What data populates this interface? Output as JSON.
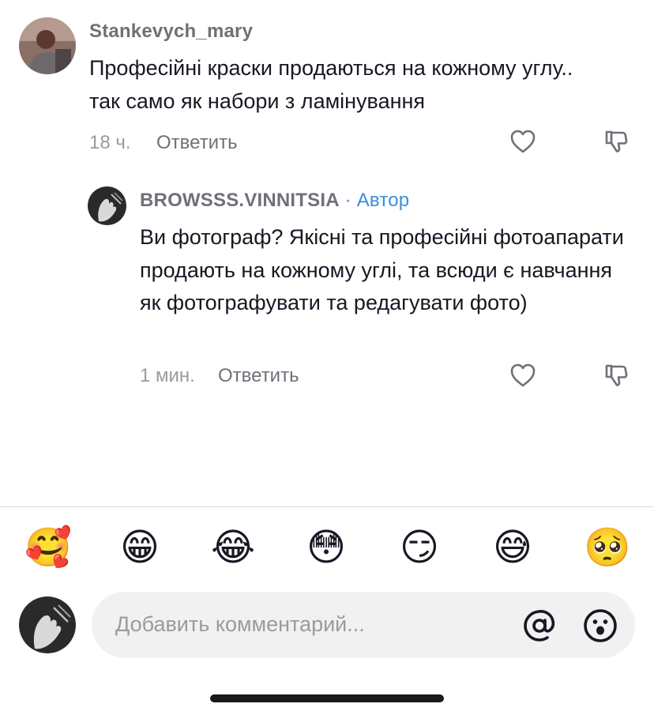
{
  "comments": [
    {
      "username": "Stankevych_mary",
      "text": "Професійні краски продаються на кожному углу.. так само як набори з ламінування",
      "time": "18 ч.",
      "reply_label": "Ответить"
    }
  ],
  "replies": [
    {
      "username": "BROWSSS.VINNITSIA",
      "separator": " · ",
      "author_badge": "Автор",
      "text": "Ви фотограф? Якісні та професійні фотоапарати продають на кожному углі, та всюди є навчання як фотографувати та редагувати фото)",
      "time": "1 мин.",
      "reply_label": "Ответить"
    }
  ],
  "emoji_bar": [
    "🥰",
    "😁",
    "😂",
    "😳",
    "😏",
    "😅",
    "🥺"
  ],
  "composer": {
    "placeholder": "Добавить комментарий...",
    "mention_icon": "at-icon",
    "emoji_icon": "emoji-face-icon"
  },
  "colors": {
    "author_badge": "#3b8fd9",
    "username": "#6f7078",
    "meta": "#9a9aa0",
    "input_bg": "#f1f1f2"
  }
}
